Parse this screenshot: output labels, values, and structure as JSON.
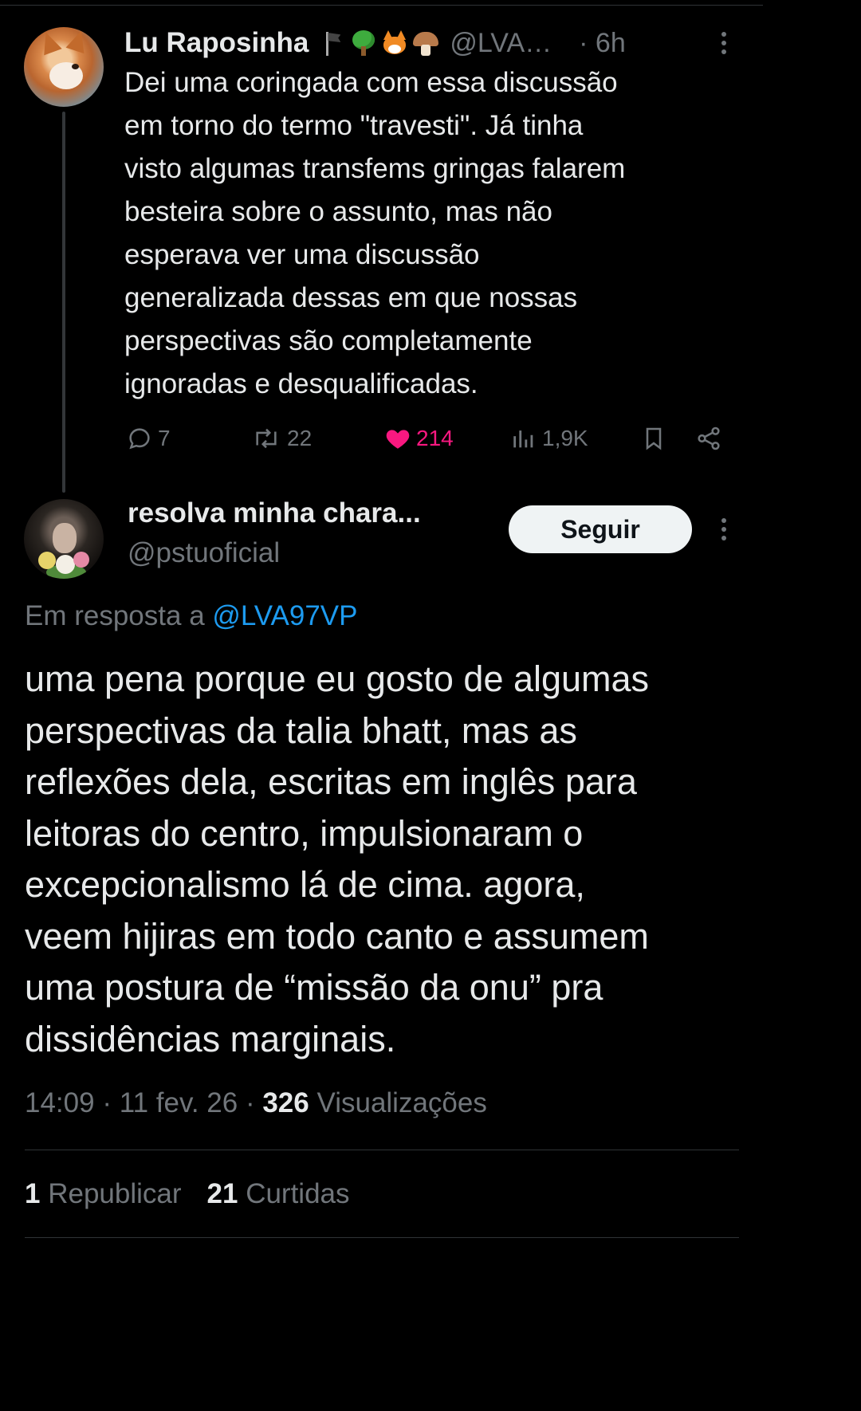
{
  "parent_tweet": {
    "author_name": "Lu Raposinha",
    "emoji_names": [
      "black-flag-icon",
      "tree-icon",
      "fox-icon",
      "mushroom-icon"
    ],
    "handle": "@LVA…",
    "time": "· 6h",
    "text": "Dei uma coringada com essa discussão\nem torno do termo \"travesti\". Já tinha\nvisto algumas transfems gringas falarem\nbesteira sobre o assunto, mas não\nesperava ver uma discussão\ngeneralizada dessas em que nossas\nperspectivas são completamente\nignoradas  e desqualificadas.",
    "actions": {
      "replies": "7",
      "reposts": "22",
      "likes": "214",
      "views": "1,9K"
    }
  },
  "main_tweet": {
    "author_name": "resolva minha chara...",
    "handle": "@pstuoficial",
    "follow_label": "Seguir",
    "reply_prefix": "Em resposta a ",
    "reply_mention": "@LVA97VP",
    "text": "uma pena porque eu gosto de algumas\nperspectivas da talia bhatt, mas as\nreflexões dela, escritas em inglês para\nleitoras do centro, impulsionaram o\nexcepcionalismo lá de cima. agora,\nveem hijiras em todo canto e assumem\numa postura de “missão da onu” pra\ndissidências marginais.",
    "meta": {
      "time": "14:09",
      "date": "11 fev. 26",
      "views_count": "326",
      "views_label": "Visualizações"
    },
    "stats": {
      "reposts_count": "1",
      "reposts_label": "Republicar",
      "likes_count": "21",
      "likes_label": "Curtidas"
    }
  },
  "colors": {
    "background": "#000000",
    "text_primary": "#e7e9ea",
    "text_secondary": "#71767b",
    "link": "#1d9bf0",
    "like": "#f91880",
    "divider": "#2f3336"
  }
}
